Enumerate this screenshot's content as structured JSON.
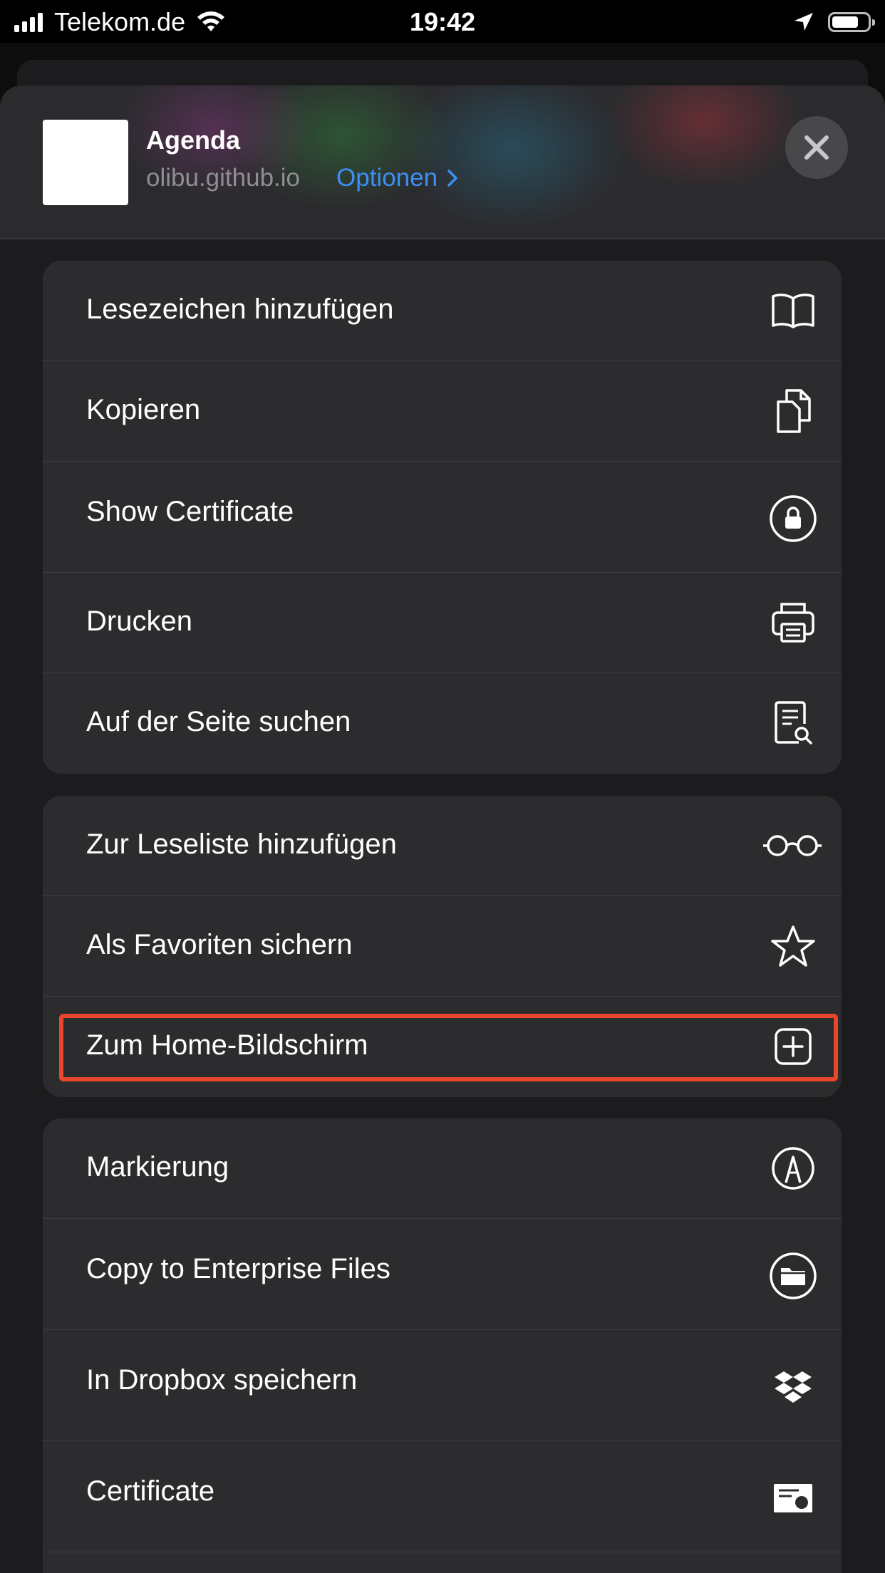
{
  "status_bar": {
    "carrier": "Telekom.de",
    "time": "19:42",
    "icons": [
      "signal-icon",
      "wifi-icon",
      "location-icon",
      "battery-icon"
    ],
    "battery_level": 0.75
  },
  "header": {
    "site_title": "Agenda",
    "site_url": "olibu.github.io",
    "options_label": "Optionen",
    "close_icon": "close-icon"
  },
  "groups": [
    {
      "items": [
        {
          "label": "Lesezeichen hinzufügen",
          "icon": "book-icon"
        },
        {
          "label": "Kopieren",
          "icon": "copy-icon"
        },
        {
          "label": "Show Certificate",
          "icon": "lock-icon"
        },
        {
          "label": "Drucken",
          "icon": "printer-icon"
        },
        {
          "label": "Auf der Seite suchen",
          "icon": "find-in-page-icon"
        }
      ]
    },
    {
      "items": [
        {
          "label": "Zur Leseliste hinzufügen",
          "icon": "glasses-icon"
        },
        {
          "label": "Als Favoriten sichern",
          "icon": "star-icon"
        },
        {
          "label": "Zum Home-Bildschirm",
          "icon": "plus-square-icon",
          "highlighted": true
        }
      ]
    },
    {
      "items": [
        {
          "label": "Markierung",
          "icon": "markup-icon"
        },
        {
          "label": "Copy to Enterprise Files",
          "icon": "folder-icon"
        },
        {
          "label": "In Dropbox speichern",
          "icon": "dropbox-icon"
        },
        {
          "label": "Certificate",
          "icon": "certificate-icon"
        }
      ]
    }
  ],
  "colors": {
    "background": "#1c1c1e",
    "group_background": "#2c2c2e",
    "accent": "#3d8ff5",
    "highlight": "#e8462d"
  }
}
